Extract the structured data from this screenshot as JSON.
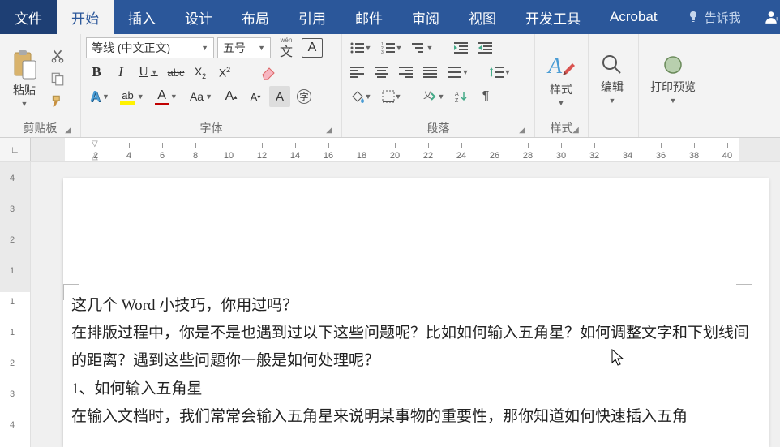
{
  "tabs": {
    "file": "文件",
    "home": "开始",
    "insert": "插入",
    "design": "设计",
    "layout": "布局",
    "references": "引用",
    "mailings": "邮件",
    "review": "审阅",
    "view": "视图",
    "developer": "开发工具",
    "acrobat": "Acrobat",
    "tell_me": "告诉我",
    "share": "共"
  },
  "groups": {
    "clipboard": {
      "label": "剪贴板",
      "paste": "粘贴"
    },
    "font": {
      "label": "字体",
      "font_name": "等线 (中文正文)",
      "font_size": "五号",
      "phonetic": "文",
      "phonetic_sup": "wén",
      "char_border": "A",
      "bold": "B",
      "italic": "I",
      "underline": "U",
      "strike": "abc",
      "sub": "X",
      "sup": "X",
      "text_effect": "A",
      "highlight": "ab",
      "font_color": "A",
      "change_case": "Aa",
      "grow": "A",
      "shrink": "A",
      "char_shade": "A",
      "enclose": "字"
    },
    "paragraph": {
      "label": "段落"
    },
    "styles": {
      "label": "样式",
      "btn": "样式"
    },
    "editing": {
      "btn": "编辑"
    },
    "print": {
      "btn": "打印预览"
    }
  },
  "ruler": {
    "marks": [
      "2",
      "4",
      "6",
      "8",
      "10",
      "12",
      "14",
      "16",
      "18",
      "20",
      "22",
      "24",
      "26",
      "28",
      "30",
      "32",
      "34",
      "36",
      "38",
      "40"
    ]
  },
  "vruler": {
    "marks": [
      "4",
      "3",
      "2",
      "1",
      "1",
      "1",
      "2",
      "3",
      "4"
    ]
  },
  "document": {
    "p1": "这几个 Word 小技巧，你用过吗？",
    "p2": "在排版过程中，你是不是也遇到过以下这些问题呢？比如如何输入五角星？如何调整文字和下划线间的距离？遇到这些问题你一般是如何处理呢？",
    "p3": "1、如何输入五角星",
    "p4": "在输入文档时，我们常常会输入五角星来说明某事物的重要性，那你知道如何快速插入五角"
  }
}
